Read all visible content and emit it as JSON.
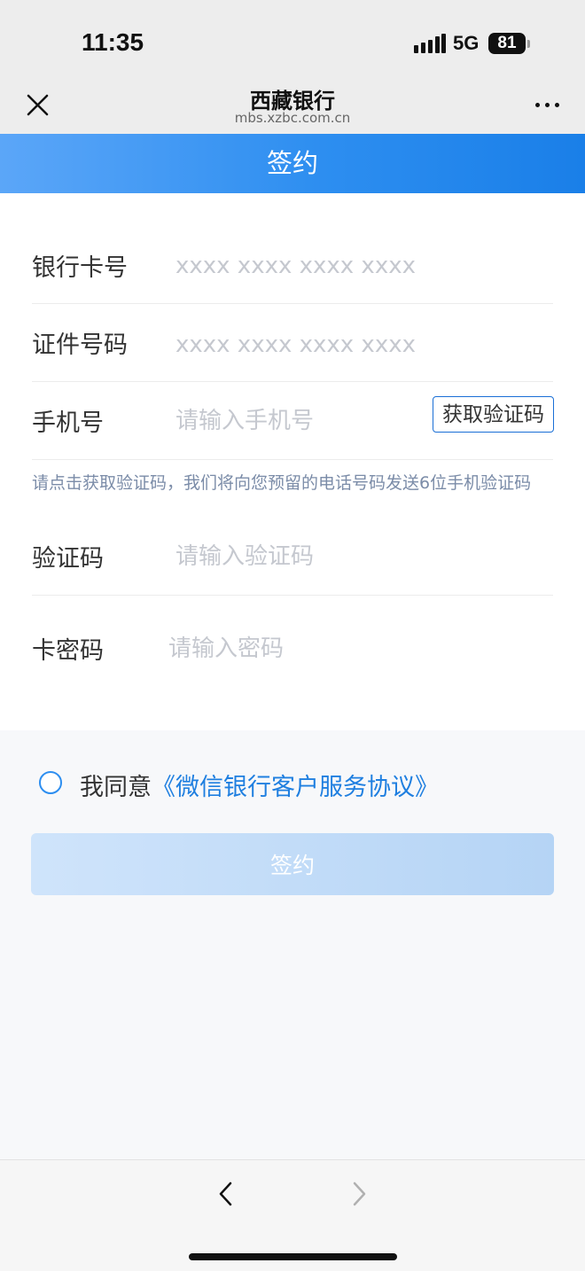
{
  "status_bar": {
    "time": "11:35",
    "network": "5G",
    "battery": "81"
  },
  "nav": {
    "title": "西藏银行",
    "url": "mbs.xzbc.com.cn"
  },
  "header": {
    "title": "签约"
  },
  "form": {
    "card_number": {
      "label": "银行卡号",
      "placeholder": "xxxx xxxx xxxx xxxx"
    },
    "id_number": {
      "label": "证件号码",
      "placeholder": "xxxx xxxx xxxx xxxx"
    },
    "phone": {
      "label": "手机号",
      "placeholder": "请输入手机号",
      "sms_button": "获取验证码"
    },
    "hint": "请点击获取验证码，我们将向您预留的电话号码发送6位手机验证码",
    "code": {
      "label": "验证码",
      "placeholder": "请输入验证码"
    },
    "password": {
      "label": "卡密码",
      "placeholder": "请输入密码"
    }
  },
  "agreement": {
    "prefix": "我同意",
    "link": "《微信银行客户服务协议》"
  },
  "submit_label": "签约",
  "colors": {
    "accent": "#2d8ef0",
    "link": "#1f7fe0",
    "submit_disabled": "#b5d4f5"
  },
  "icons": {
    "close": "close-icon",
    "more": "more-icon",
    "back": "chevron-left-icon",
    "forward": "chevron-right-icon"
  }
}
